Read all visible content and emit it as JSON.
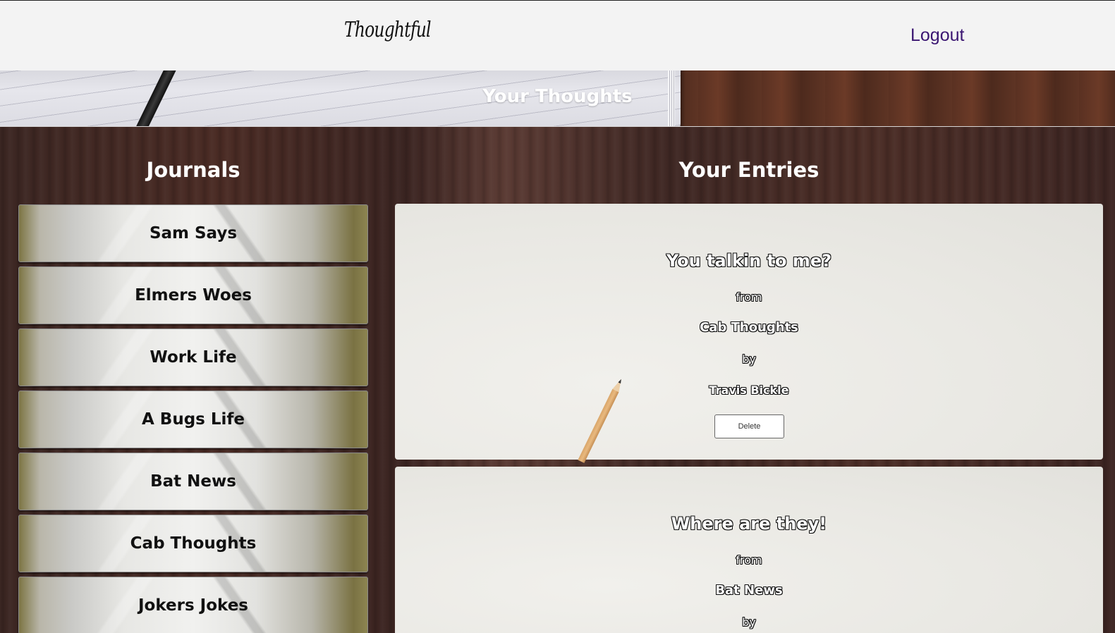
{
  "nav": {
    "brand": "Thoughtful",
    "logout_label": "Logout",
    "logout_color": "#3b1672"
  },
  "hero": {
    "title": "Your Thoughts"
  },
  "journals": {
    "heading": "Journals",
    "items": [
      {
        "label": "Sam Says"
      },
      {
        "label": "Elmers Woes"
      },
      {
        "label": "Work Life"
      },
      {
        "label": "A Bugs Life"
      },
      {
        "label": "Bat News"
      },
      {
        "label": "Cab Thoughts"
      },
      {
        "label": "Jokers Jokes"
      }
    ]
  },
  "entries": {
    "heading": "Your Entries",
    "items": [
      {
        "title": "You talkin to me?",
        "from_label": "from",
        "journal": "Cab Thoughts",
        "by_label": "by",
        "author": "Travis Bickle",
        "delete_label": "Delete"
      },
      {
        "title": "Where are they!",
        "from_label": "from",
        "journal": "Bat News",
        "by_label": "by"
      }
    ]
  }
}
